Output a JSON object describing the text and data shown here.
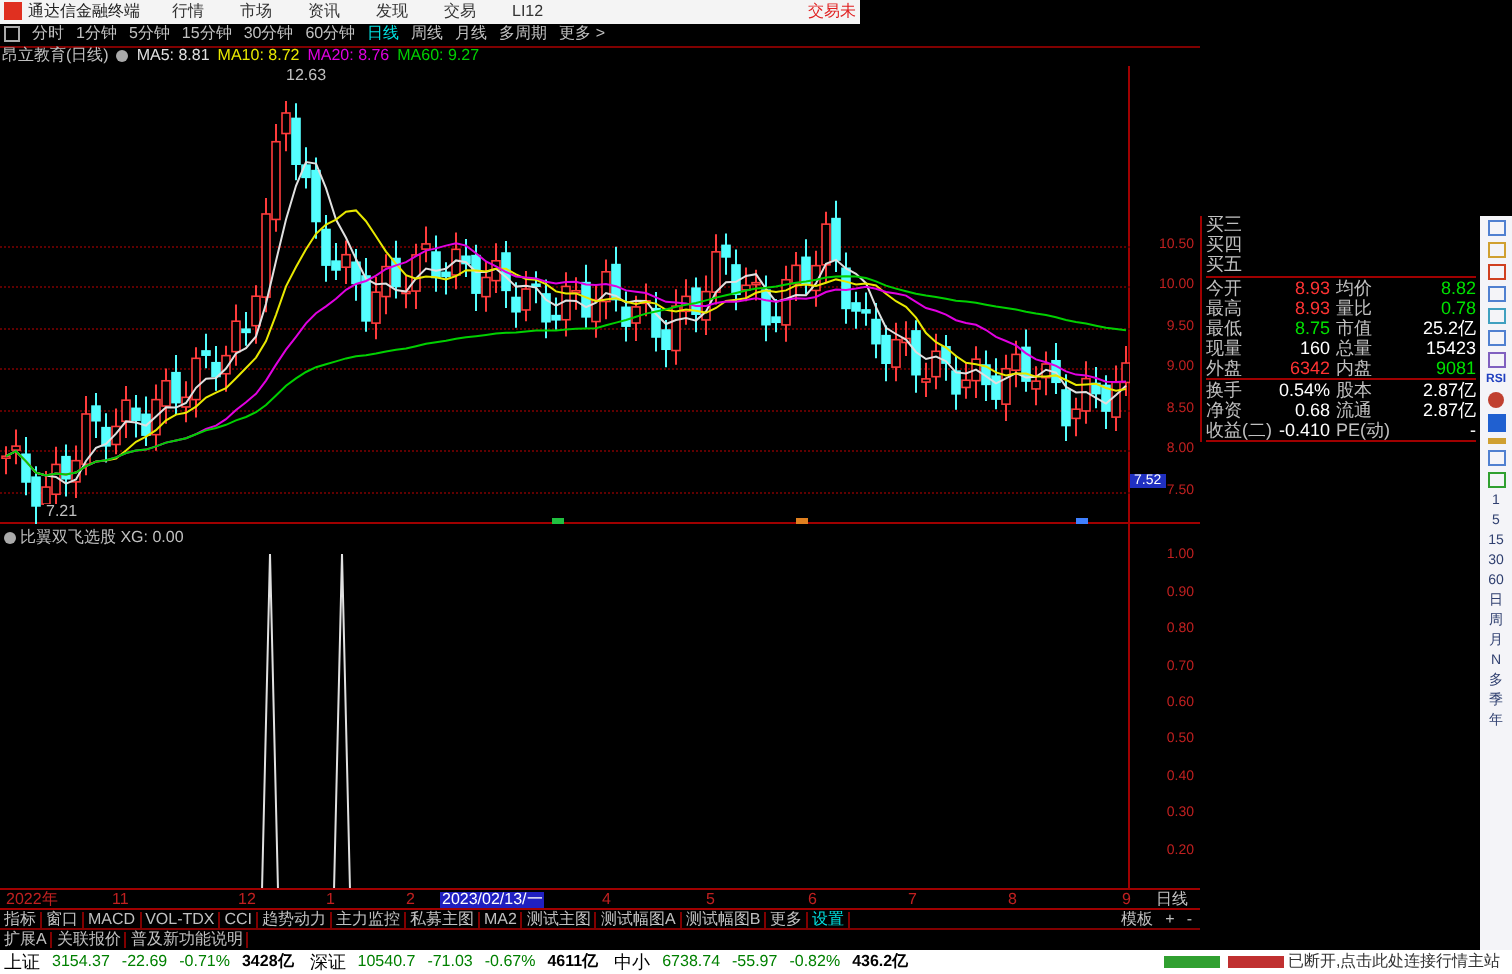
{
  "menu_bar": {
    "app_title": "通达信金融终端",
    "items": [
      "行情",
      "市场",
      "资讯",
      "发现",
      "交易",
      "LI12"
    ],
    "right_text": "交易未"
  },
  "periods": [
    {
      "label": "分时",
      "selected": false
    },
    {
      "label": "1分钟",
      "selected": false
    },
    {
      "label": "5分钟",
      "selected": false
    },
    {
      "label": "15分钟",
      "selected": false
    },
    {
      "label": "30分钟",
      "selected": false
    },
    {
      "label": "60分钟",
      "selected": false
    },
    {
      "label": "日线",
      "selected": true
    },
    {
      "label": "周线",
      "selected": false
    },
    {
      "label": "月线",
      "selected": false
    },
    {
      "label": "多周期",
      "selected": false
    },
    {
      "label": "更多 >",
      "selected": false
    }
  ],
  "chart_header": {
    "title": "昂立教育(日线)",
    "ma": [
      {
        "label": "MA5: 8.81",
        "color": "#e0e0e0"
      },
      {
        "label": "MA10: 8.72",
        "color": "#e8e800"
      },
      {
        "label": "MA20: 8.76",
        "color": "#e000e0"
      },
      {
        "label": "MA60: 9.27",
        "color": "#00d000"
      }
    ]
  },
  "price_chart": {
    "high_label": "12.63",
    "low_label": "7.21",
    "current_price": "7.52",
    "axis": [
      "10.50",
      "10.00",
      "9.50",
      "9.00",
      "8.50",
      "8.00",
      "7.50"
    ]
  },
  "indicator": {
    "title": "比翼双飞选股 XG: 0.00",
    "axis": [
      "1.00",
      "0.90",
      "0.80",
      "0.70",
      "0.60",
      "0.50",
      "0.40",
      "0.30",
      "0.20"
    ]
  },
  "time_axis": [
    {
      "label": "2022年",
      "selected": false
    },
    {
      "label": "11",
      "selected": false
    },
    {
      "label": "12",
      "selected": false
    },
    {
      "label": "1",
      "selected": false
    },
    {
      "label": "2",
      "selected": false
    },
    {
      "label": "2023/02/13/一",
      "selected": true
    },
    {
      "label": "4",
      "selected": false
    },
    {
      "label": "5",
      "selected": false
    },
    {
      "label": "6",
      "selected": false
    },
    {
      "label": "7",
      "selected": false
    },
    {
      "label": "8",
      "selected": false
    },
    {
      "label": "9",
      "selected": false
    }
  ],
  "time_axis_period": "日线",
  "indicator_tabs": [
    {
      "label": "指标",
      "selected": false
    },
    {
      "label": "窗口",
      "selected": false
    },
    {
      "label": "MACD",
      "selected": false
    },
    {
      "label": "VOL-TDX",
      "selected": false
    },
    {
      "label": "CCI",
      "selected": false
    },
    {
      "label": "趋势动力",
      "selected": false
    },
    {
      "label": "主力监控",
      "selected": false
    },
    {
      "label": "私募主图",
      "selected": false
    },
    {
      "label": "MA2",
      "selected": false
    },
    {
      "label": "测试主图",
      "selected": false
    },
    {
      "label": "测试幅图A",
      "selected": false
    },
    {
      "label": "测试幅图B",
      "selected": false
    },
    {
      "label": "更多",
      "selected": false
    },
    {
      "label": "设置",
      "selected": true
    }
  ],
  "template_controls": [
    "模板",
    "+",
    "-"
  ],
  "extra_tabs": [
    "扩展A",
    "关联报价",
    "普及新功能说明"
  ],
  "quote_panel": {
    "order_book": [
      "买三",
      "买四",
      "买五"
    ],
    "rows": [
      {
        "label": "今开",
        "value": "8.93",
        "color": "#ff3333"
      },
      {
        "label": "均价",
        "value": "8.82",
        "color": "#00e000"
      },
      {
        "label": "最高",
        "value": "8.93",
        "color": "#ff3333"
      },
      {
        "label": "量比",
        "value": "0.78",
        "color": "#00e000"
      },
      {
        "label": "最低",
        "value": "8.75",
        "color": "#00e000"
      },
      {
        "label": "市值",
        "value": "25.2亿",
        "color": "#ffffff"
      },
      {
        "label": "现量",
        "value": "160",
        "color": "#ffffff"
      },
      {
        "label": "总量",
        "value": "15423",
        "color": "#ffffff"
      },
      {
        "label": "外盘",
        "value": "6342",
        "color": "#ff3333"
      },
      {
        "label": "内盘",
        "value": "9081",
        "color": "#00e000"
      }
    ],
    "stats": [
      {
        "label": "换手",
        "value": "0.54%",
        "label2": "股本",
        "value2": "2.87亿"
      },
      {
        "label": "净资",
        "value": "0.68",
        "label2": "流通",
        "value2": "2.87亿"
      },
      {
        "label": "收益(二)",
        "value": "-0.410",
        "label2": "PE(动)",
        "value2": "-"
      }
    ]
  },
  "toolbar": {
    "rsi_label": "RSI",
    "periods": [
      "1",
      "5",
      "15",
      "30",
      "60",
      "日",
      "周",
      "月",
      "N",
      "多",
      "季",
      "年"
    ]
  },
  "status_bar": {
    "indices": [
      {
        "name": "上证",
        "value": "3154.37",
        "change": "-22.69",
        "percent": "-0.71%",
        "amount": "3428亿"
      },
      {
        "name": "深证",
        "value": "10540.7",
        "change": "-71.03",
        "percent": "-0.67%",
        "amount": "4611亿"
      },
      {
        "name": "中小",
        "value": "6738.74",
        "change": "-55.97",
        "percent": "-0.82%",
        "amount": "436.2亿"
      }
    ],
    "message": "已断开,点击此处连接行情主站"
  }
}
